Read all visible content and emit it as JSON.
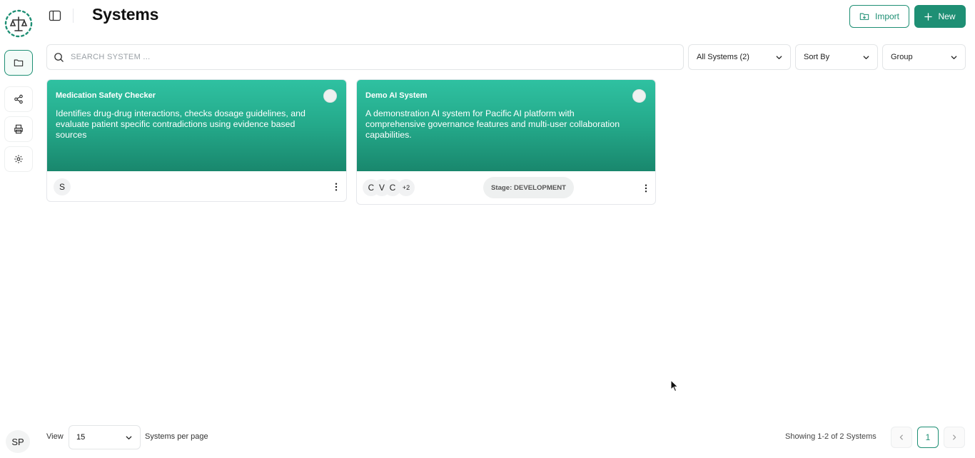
{
  "header": {
    "title": "Systems",
    "import_label": "Import",
    "new_label": "New"
  },
  "search": {
    "placeholder": "SEARCH SYSTEM ..."
  },
  "filters": {
    "systems": "All Systems (2)",
    "sort": "Sort By",
    "group": "Group"
  },
  "cards": [
    {
      "title": "Medication Safety Checker",
      "description": "Identifies drug-drug interactions, checks dosage guidelines, and evaluate patient specific contradictions using evidence based sources",
      "avatars": [
        "S"
      ]
    },
    {
      "title": "Demo AI System",
      "description": "A demonstration AI system for Pacific AI platform with comprehensive governance features and multi-user collaboration capabilities.",
      "avatars": [
        "C",
        "V",
        "C"
      ],
      "more_count": "+2",
      "stage": "Stage: DEVELOPMENT"
    }
  ],
  "user": {
    "initials": "SP"
  },
  "pagination": {
    "view_label": "View",
    "per_page": "15",
    "per_page_label": "Systems per page",
    "summary": "Showing 1-2 of 2 Systems",
    "current_page": "1"
  },
  "colors": {
    "accent": "#1e8f74",
    "card_gradient_top": "#2fc1a1",
    "card_gradient_bottom": "#19876d"
  },
  "icons": {
    "sidebar": [
      "folder-icon",
      "share-icon",
      "printer-icon",
      "gear-icon"
    ],
    "header": [
      "sidebar-toggle-icon",
      "import-icon",
      "plus-icon"
    ]
  }
}
